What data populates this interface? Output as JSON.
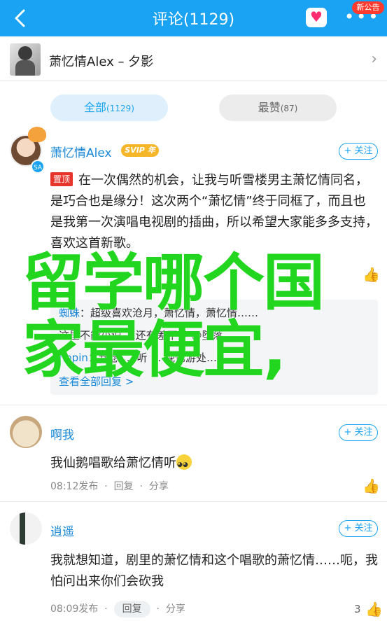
{
  "header": {
    "title": "评论(1129)",
    "badge": "新公告",
    "more": "•••",
    "heart": "♥"
  },
  "song": {
    "title": "萧忆情Alex – 夕影",
    "chevron": "›"
  },
  "filters": {
    "all_label": "全部",
    "all_count": "(1129)",
    "hot_label": "最赞",
    "hot_count": "(87)"
  },
  "comments": [
    {
      "user": "萧忆情Alex",
      "vip": "SVIP 年",
      "avatar_tag": "SA",
      "follow": "+ 关注",
      "pinned": "置顶",
      "text": "在一次偶然的机会，让我与听雪楼男主萧忆情同名，是巧合也是缘分！这次两个“萧忆情”终于同框了，而且也是我第一次演唱电视剧的插曲，所以希望大家能多多支持，喜欢这首新歌。",
      "replies": [
        {
          "name": "蜘蛛",
          "sep": "：",
          "text": "超级喜欢沧月，萧忆情，萧忆情……"
        },
        {
          "name": "",
          "sep": "",
          "text": "这里不能小说 …还有差不多 @堕落"
        },
        {
          "name": "hopin",
          "sep": "：",
          "text": "我想 … 听 … 晚忆游处…"
        }
      ],
      "replies_more": "查看全部回复 >"
    },
    {
      "user": "啊我",
      "follow": "+ 关注",
      "text": "我仙鹅唱歌给萧忆情听",
      "time": "08:12发布",
      "reply": "回复",
      "share": "分享",
      "dot": "·"
    },
    {
      "user": "逍遥",
      "follow": "+ 关注",
      "text": "我就想知道，剧里的萧忆情和这个唱歌的萧忆情……呃，我怕问出来你们会砍我",
      "time": "08:09发布",
      "reply": "回复",
      "share": "分享",
      "dot": "·",
      "likes": "3"
    }
  ],
  "overlay": {
    "text": "留学哪个国家最便宜,"
  }
}
